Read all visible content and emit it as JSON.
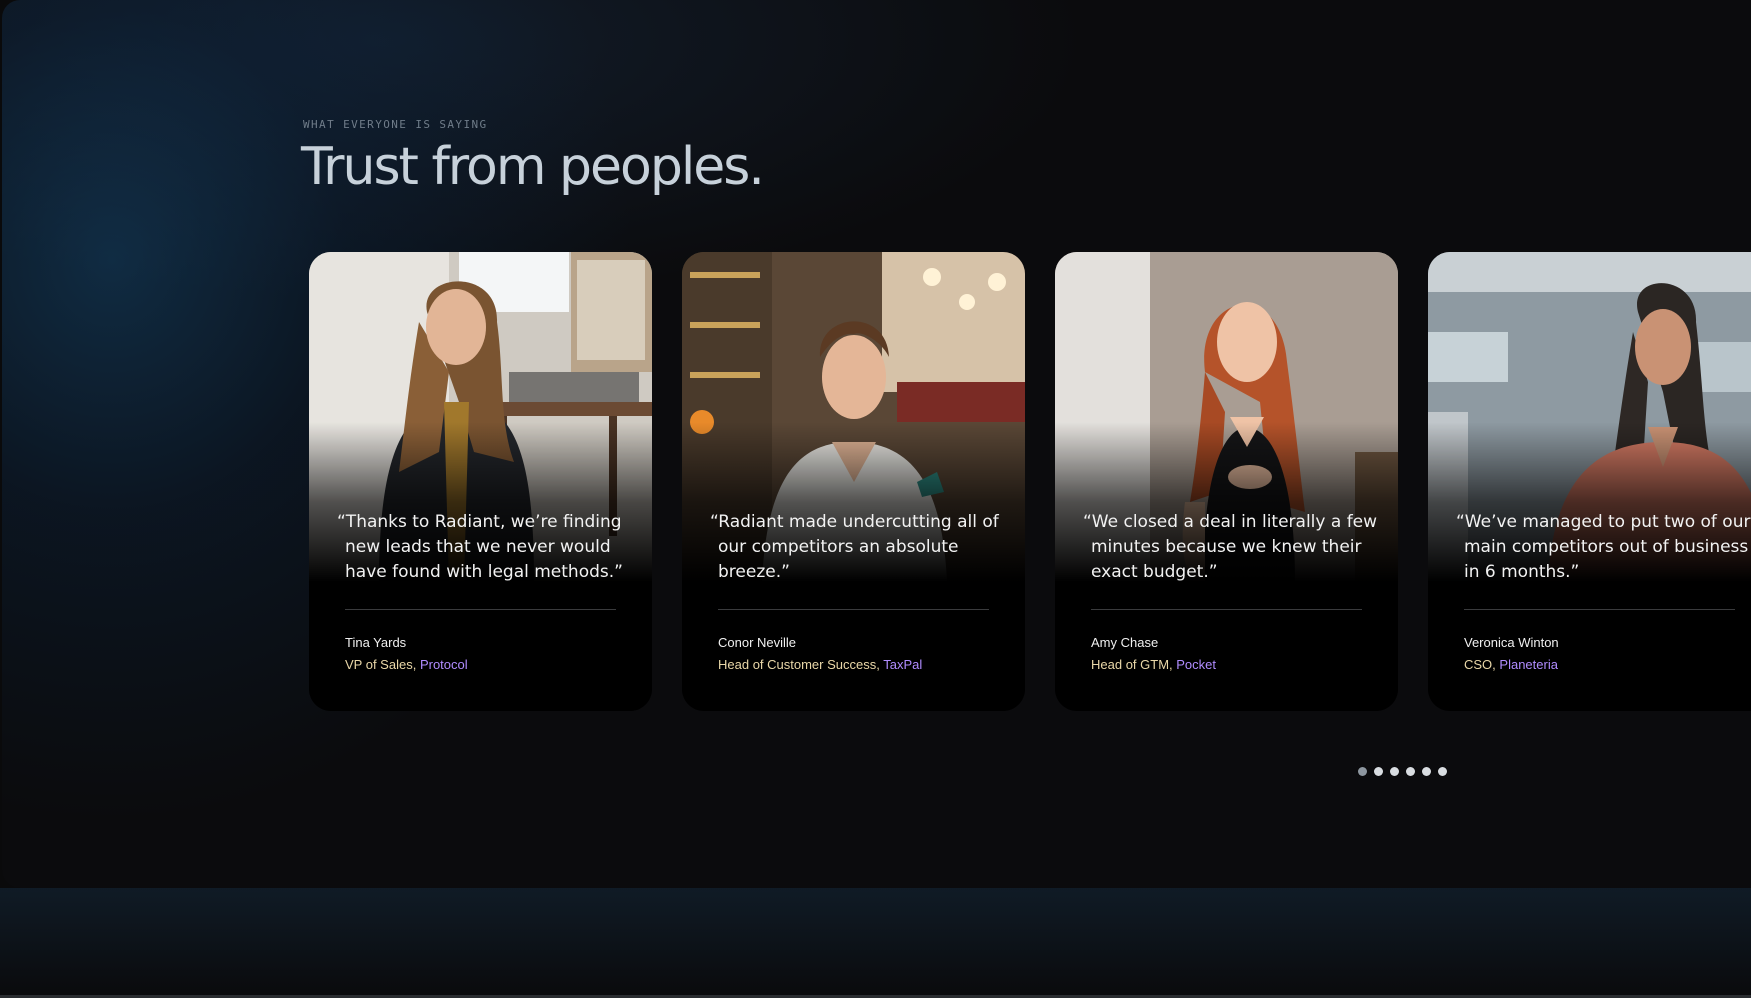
{
  "section": {
    "eyebrow": "WHAT EVERYONE IS SAYING",
    "title": "Trust from peoples."
  },
  "testimonials": [
    {
      "quote": "“Thanks to Radiant, we’re finding new leads that we never would have found with legal methods.”",
      "name": "Tina Yards",
      "role": "VP of Sales",
      "company": "Protocol"
    },
    {
      "quote": "“Radiant made undercutting all of our competitors an absolute breeze.”",
      "name": "Conor Neville",
      "role": "Head of Customer Success",
      "company": "TaxPal"
    },
    {
      "quote": "“We closed a deal in literally a few minutes because we knew their exact budget.”",
      "name": "Amy Chase",
      "role": "Head of GTM",
      "company": "Pocket"
    },
    {
      "quote": "“We’ve managed to put two of our main competitors out of business in 6 months.”",
      "name": "Veronica Winton",
      "role": "CSO",
      "company": "Planeteria"
    }
  ],
  "pagination": {
    "count": 6,
    "active_index": 0
  },
  "colors": {
    "role_text": "#e9d7a8",
    "company_text": "#b08cff",
    "headline": "#c7d1da"
  }
}
